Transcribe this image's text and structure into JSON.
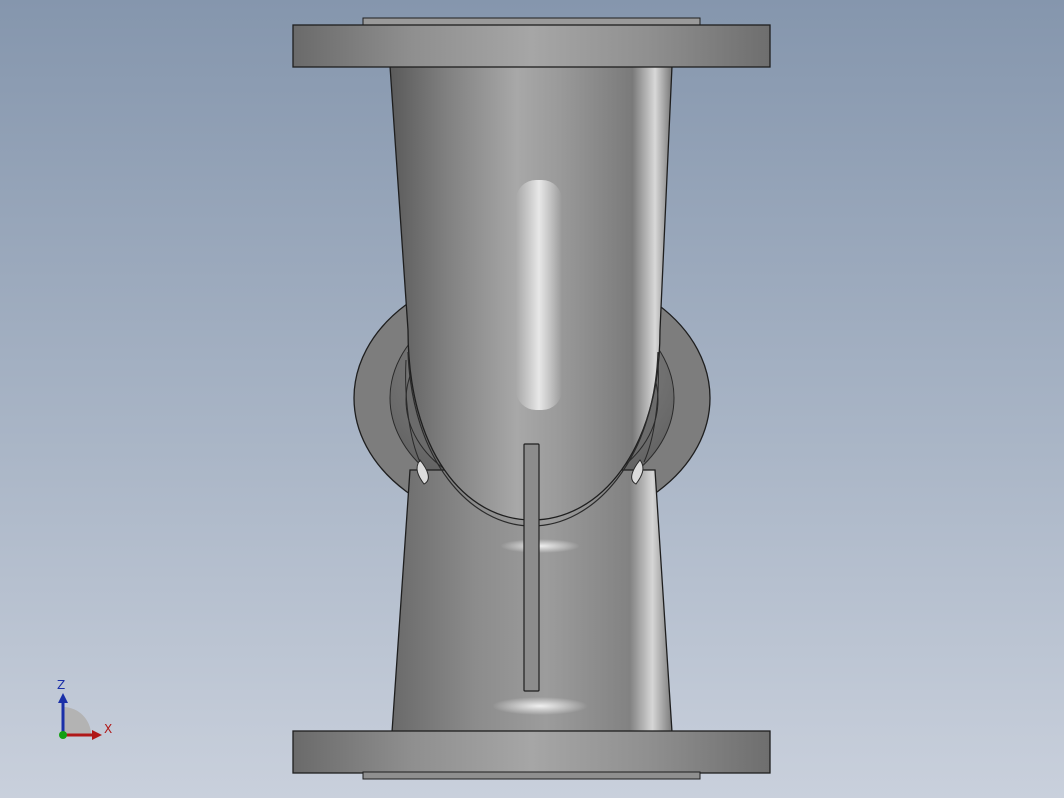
{
  "viewport": {
    "background_top": "#8596ad",
    "background_bottom": "#c9d0dc"
  },
  "model": {
    "part": "tee-pipe-fitting",
    "body_color": "#9a9a9a",
    "edge_color": "#1e1e1e"
  },
  "triad": {
    "z_label": "Z",
    "x_label": "X",
    "z_color": "#1a2fa8",
    "x_color": "#b01818",
    "y_color": "#12a012"
  }
}
